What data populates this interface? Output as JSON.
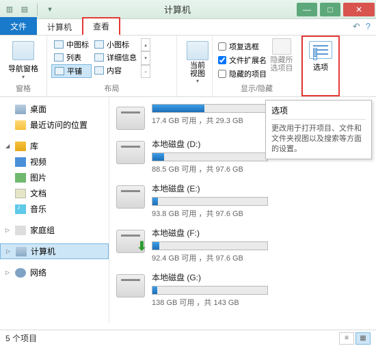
{
  "window": {
    "title": "计算机"
  },
  "tabs": {
    "file": "文件",
    "computer": "计算机",
    "view": "查看"
  },
  "ribbon": {
    "nav_pane": "导航窗格",
    "group_panes": "窗格",
    "layout_items": [
      "中图标",
      "小图标",
      "列表",
      "详细信息",
      "平铺",
      "内容"
    ],
    "group_layout": "布局",
    "current_view": "当前\n视图",
    "checkboxes": {
      "item_checkboxes": "项复选框",
      "file_ext": "文件扩展名",
      "hidden_items": "隐藏的项目"
    },
    "hide_selected": "隐藏所\n选项目",
    "group_showhide": "显示/隐藏",
    "options": "选项"
  },
  "sidebar": {
    "desktop": "桌面",
    "recent": "最近访问的位置",
    "libraries": "库",
    "videos": "视频",
    "pictures": "图片",
    "documents": "文档",
    "music": "音乐",
    "homegroup": "家庭组",
    "computer": "计算机",
    "network": "网络"
  },
  "drives": [
    {
      "name": "",
      "free": "17.4 GB 可用 ，共 29.3 GB",
      "pct": 45
    },
    {
      "name": "本地磁盘 (D:)",
      "free": "88.5 GB 可用 ，共 97.6 GB",
      "pct": 10
    },
    {
      "name": "本地磁盘 (E:)",
      "free": "93.8 GB 可用 ，共 97.6 GB",
      "pct": 5
    },
    {
      "name": "本地磁盘 (F:)",
      "free": "92.4 GB 可用 ，共 97.6 GB",
      "pct": 6,
      "dl": true
    },
    {
      "name": "本地磁盘 (G:)",
      "free": "138 GB 可用 ，共 143 GB",
      "pct": 4
    }
  ],
  "tooltip": {
    "title": "选项",
    "body": "更改用于打开项目、文件和文件夹视图以及搜索等方面的设置。"
  },
  "status": {
    "count": "5 个项目"
  }
}
